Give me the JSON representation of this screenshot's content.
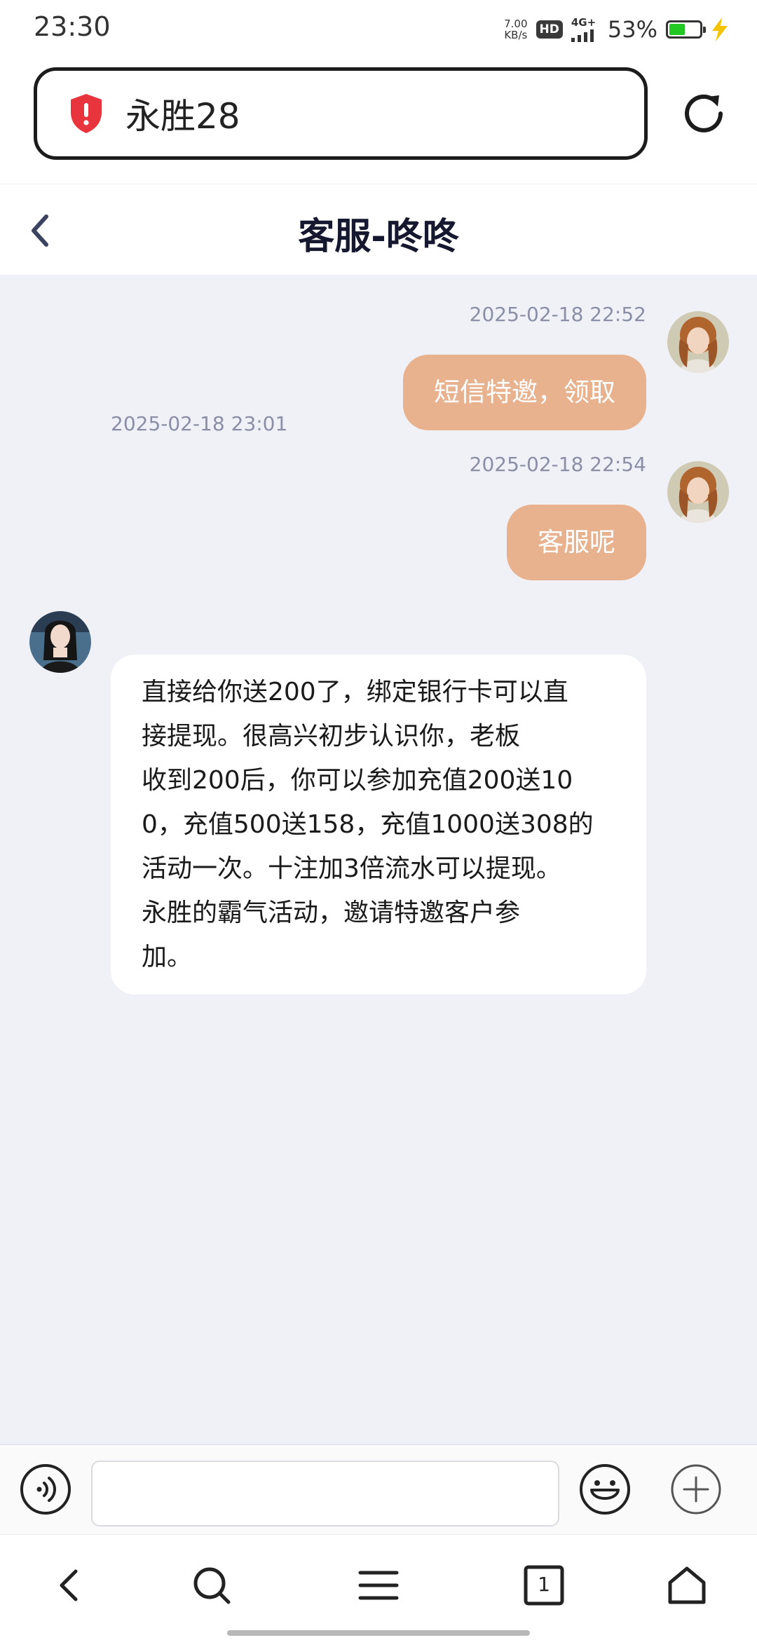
{
  "status": {
    "time": "23:30",
    "net_speed_value": "7.00",
    "net_speed_unit": "KB/s",
    "hd": "HD",
    "network": "4G+",
    "battery": "53%",
    "battery_level": 0.53
  },
  "browser": {
    "url": "永胜28"
  },
  "chat": {
    "title": "客服-咚咚",
    "messages": [
      {
        "direction": "outgoing",
        "time": "2025-02-18 22:52",
        "text": "短信特邀，领取"
      },
      {
        "direction": "outgoing",
        "time": "2025-02-18 22:54",
        "text": "客服呢"
      },
      {
        "direction": "incoming",
        "time": "2025-02-18 23:01",
        "lines": [
          "直接给你送200了，绑定银行卡可以直",
          "接提现。很高兴初步认识你，老板",
          "收到200后，你可以参加充值200送10",
          "0，充值500送158，充值1000送308的",
          "活动一次。十注加3倍流水可以提现。",
          "永胜的霸气活动，邀请特邀客户参",
          "加。"
        ]
      }
    ]
  },
  "composer": {
    "placeholder": ""
  },
  "nav": {
    "tab_count": "1"
  },
  "colors": {
    "bubble_out": "#e8b28e",
    "chat_bg": "#f0f1f7",
    "shield": "#e8343c"
  }
}
